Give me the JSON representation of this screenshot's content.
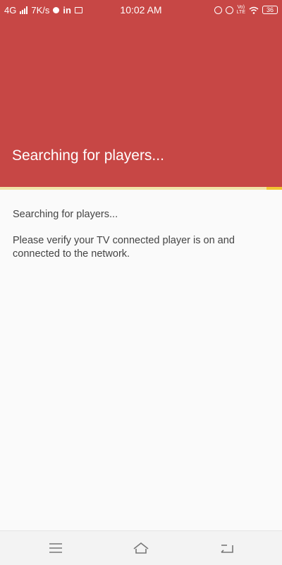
{
  "status_bar": {
    "network": "4G",
    "speed": "7K/s",
    "linkedin": "in",
    "time": "10:02 AM",
    "volte_top": "Vo)",
    "volte_bottom": "LTE",
    "battery": "36"
  },
  "app_bar": {
    "title": "Searching for players...",
    "color": "#c74745"
  },
  "progress": {
    "indeterminate": true,
    "color": "#f2c531"
  },
  "content": {
    "message1": "Searching for players...",
    "message2": "Please verify your TV connected player is on and connected to the network."
  },
  "nav_bar": {
    "buttons": [
      "menu-icon",
      "home-icon",
      "back-icon"
    ]
  }
}
